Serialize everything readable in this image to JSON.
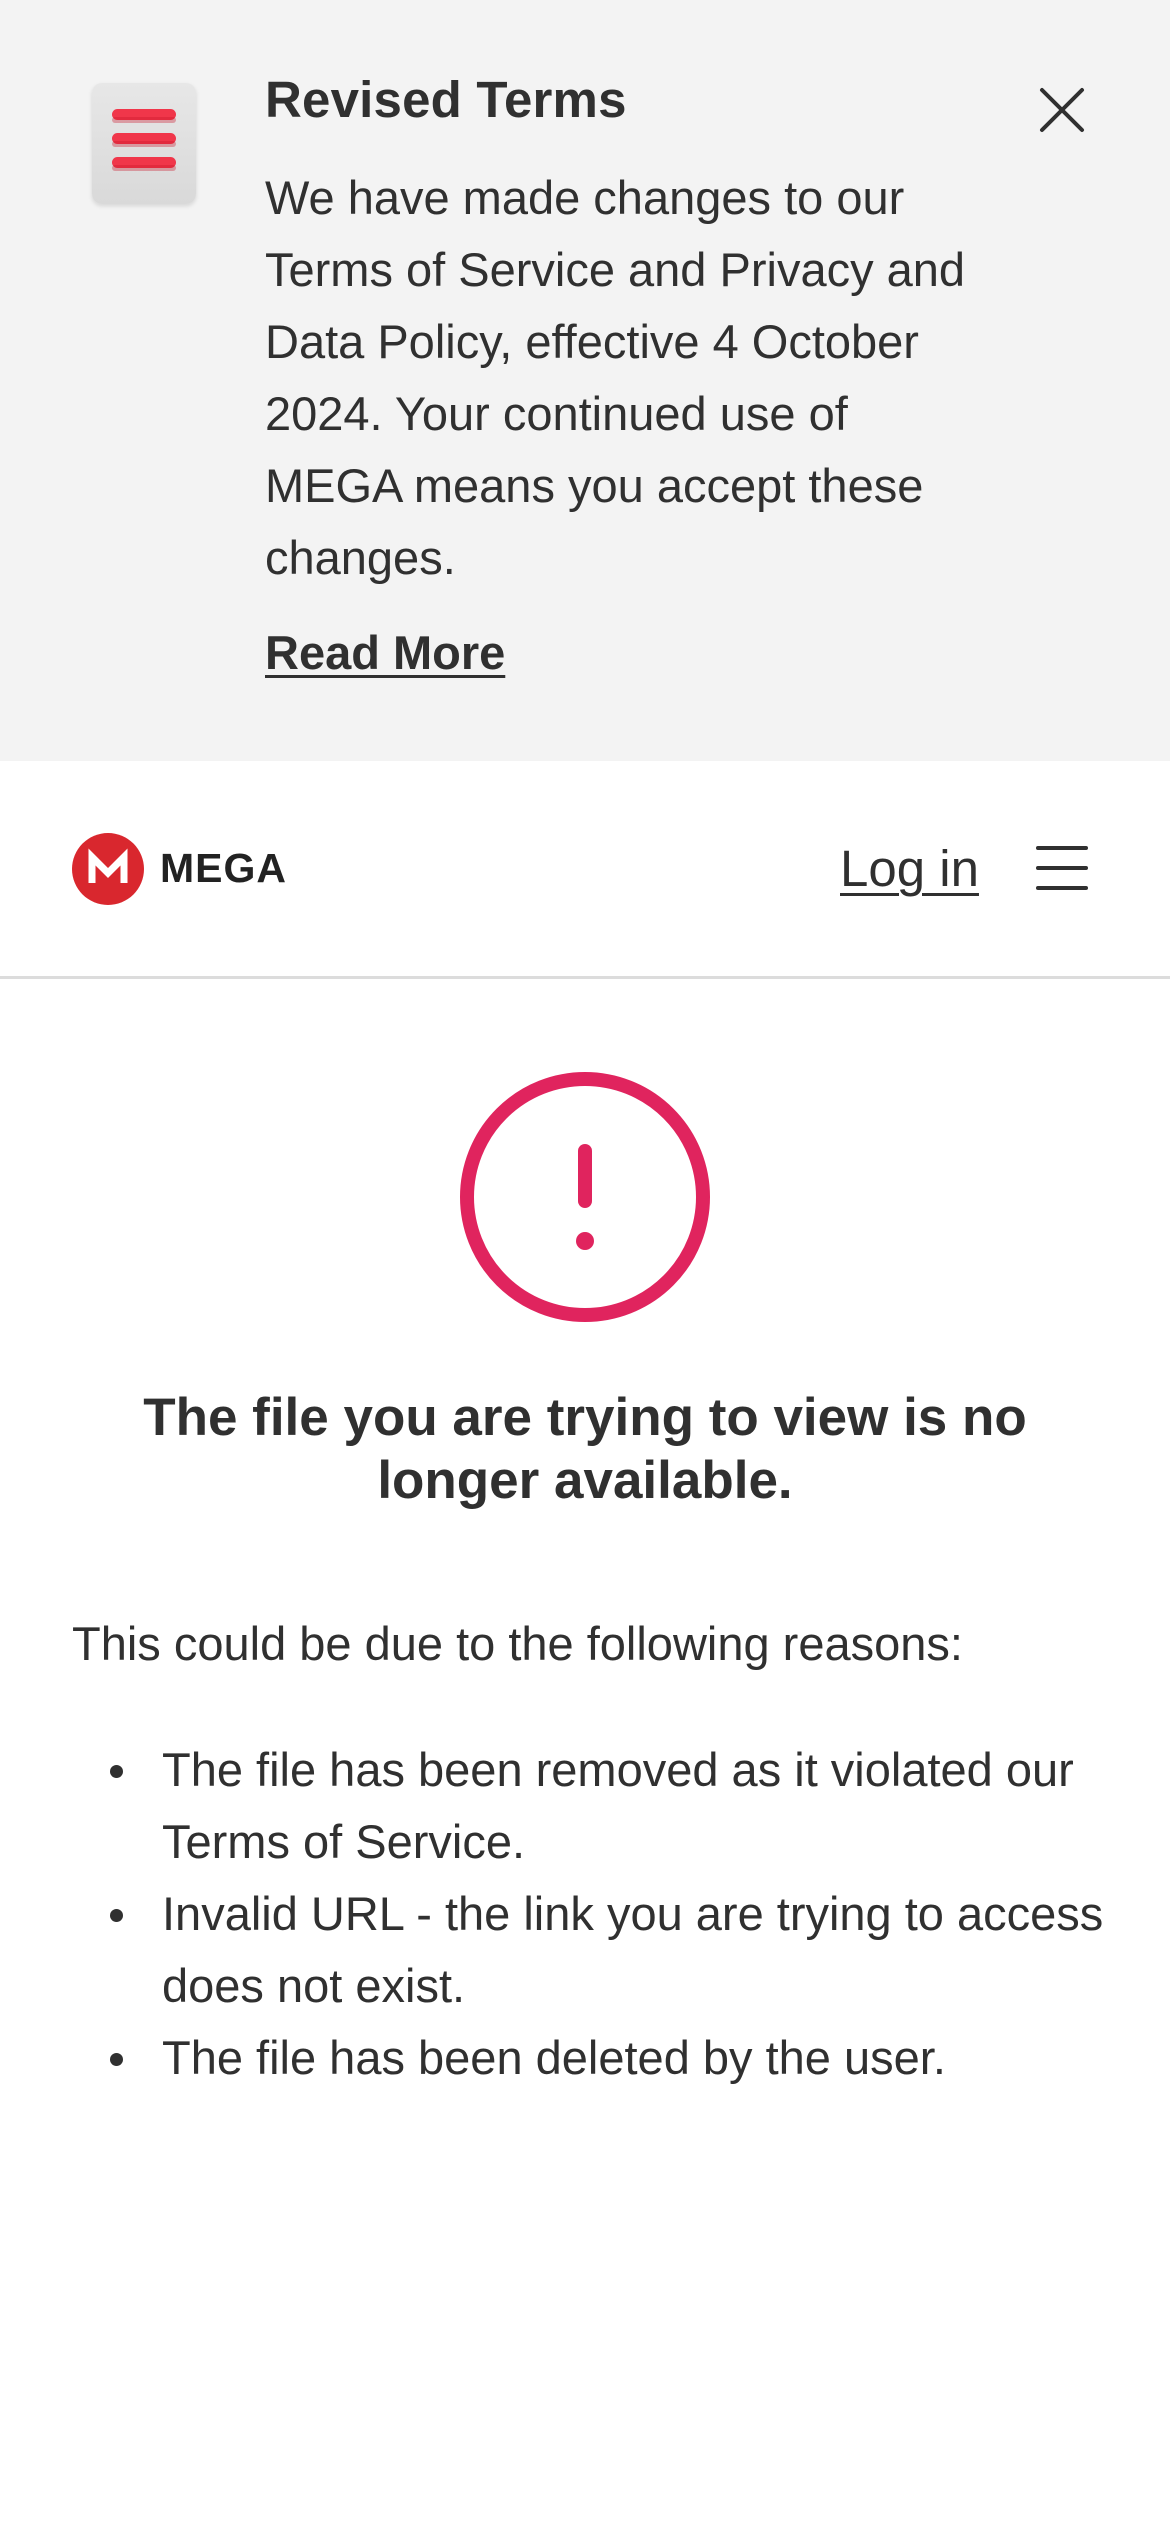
{
  "banner": {
    "title": "Revised Terms",
    "body": "We have made changes to our Terms of Service and Privacy and Data Policy, effective 4 October 2024. Your continued use of MEGA means you accept these changes.",
    "link_label": "Read More",
    "icon": "revised-terms-document-icon",
    "close_icon": "close-icon"
  },
  "header": {
    "logo_letter": "M",
    "logo_text": "MEGA",
    "login_label": "Log in",
    "menu_icon": "hamburger-menu-icon"
  },
  "error": {
    "icon": "exclamation-circle-icon",
    "title": "The file you are trying to view is no longer available.",
    "intro": "This could be due to the following reasons:",
    "reasons": [
      "The file has been removed as it violated our Terms of Service.",
      "Invalid URL - the link you are trying to access does not exist.",
      "The file has been deleted by the user."
    ]
  },
  "colors": {
    "banner_bg": "#f3f3f3",
    "brand_red": "#d9272e",
    "error_pink": "#e0245e",
    "text": "#303030"
  }
}
